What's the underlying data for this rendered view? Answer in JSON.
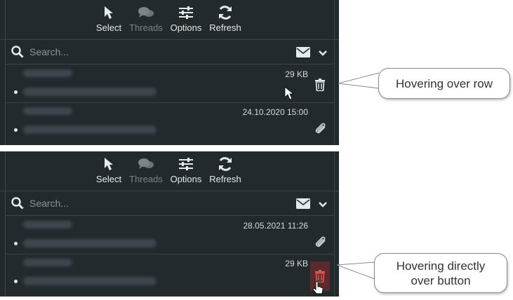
{
  "toolbar": {
    "select": "Select",
    "threads": "Threads",
    "options": "Options",
    "refresh": "Refresh"
  },
  "search": {
    "placeholder": "Search..."
  },
  "top_panel": {
    "rows": [
      {
        "meta": "29 KB",
        "action_icon": "trash-icon"
      },
      {
        "meta": "24.10.2020 15:00",
        "action_icon": "paperclip-icon"
      }
    ]
  },
  "bottom_panel": {
    "rows": [
      {
        "meta": "28.05.2021 11:26",
        "action_icon": "paperclip-icon"
      },
      {
        "meta": "29 KB",
        "action_icon": "trash-icon"
      }
    ]
  },
  "callouts": {
    "row": "Hovering over row",
    "button_line1": "Hovering directly",
    "button_line2": "over button"
  },
  "colors": {
    "panel_bg": "#222a2e",
    "text": "#e6e9ea",
    "disabled": "#7b8589",
    "trash_hover_bg": "#5a2a2c",
    "trash_hover_icon": "#e05a5a"
  }
}
